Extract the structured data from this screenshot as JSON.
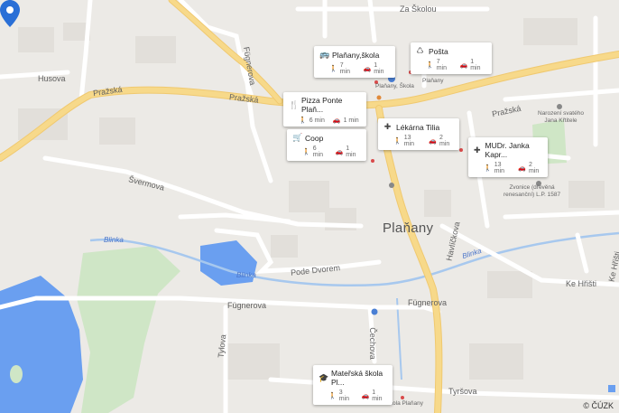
{
  "town_label": "Plaňany",
  "roads": {
    "za_skolou": "Za Školou",
    "husova": "Husova",
    "prazska_w": "Pražská",
    "prazska_c": "Pražská",
    "prazska_e": "Pražská",
    "fugnerova_v": "Fügnerova",
    "svermova": "Švermova",
    "pode_dvorem": "Pode Dvorem",
    "fugnerova_w": "Fügnerova",
    "fugnerova_e": "Fügnerova",
    "havlickova": "Havlíčkova",
    "tylova": "Tylova",
    "cechova": "Čechova",
    "tyrsova": "Tyršova",
    "ke_hristi": "Ke Hřišti",
    "ke_hristi2": "Ke Hřišti"
  },
  "water": {
    "blinka_w": "Blinka",
    "blinka_c": "Blinka",
    "blinka_e": "Blinka"
  },
  "poi_labels": {
    "narozeni": "Narození svatého\nJana Křtitele",
    "zvonice": "Zvonice (dřevěná\nrenesanční) L.P. 1587",
    "skola": "Plaňany, Škola",
    "planany": "Plaňany",
    "ms": "Mateřská škola Plaňany"
  },
  "cards": [
    {
      "title": "Plaňany,škola",
      "icon": "bus-icon",
      "walk": "7 min",
      "drive": "1 min"
    },
    {
      "title": "Pošta",
      "icon": "post-icon",
      "walk": "7 min",
      "drive": "1 min"
    },
    {
      "title": "Pizza Ponte Plaň...",
      "icon": "restaurant-icon",
      "walk": "6 min",
      "drive": "1 min"
    },
    {
      "title": "Lékárna Tilia",
      "icon": "pharmacy-icon",
      "walk": "13 min",
      "drive": "2 min"
    },
    {
      "title": "Coop",
      "icon": "cart-icon",
      "walk": "6 min",
      "drive": "1 min"
    },
    {
      "title": "MUDr. Janka Kapr...",
      "icon": "medical-icon",
      "walk": "13 min",
      "drive": "2 min"
    },
    {
      "title": "Mateřská škola Pl...",
      "icon": "school-icon",
      "walk": "3 min",
      "drive": "1 min"
    }
  ],
  "attribution": "© ČÚZK",
  "colors": {
    "water": "#a7c8ee",
    "lake": "#6a9ff0",
    "park": "#cfe6c6",
    "road_main": "#f7d98a",
    "pin": "#2a6fd6"
  }
}
